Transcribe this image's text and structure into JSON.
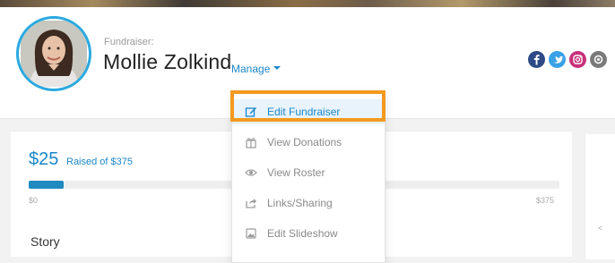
{
  "profile": {
    "label": "Fundraiser:",
    "name": "Mollie Zolkind",
    "manage_label": "Manage"
  },
  "social": [
    {
      "icon": "facebook-icon",
      "color": "#2d4a86"
    },
    {
      "icon": "twitter-icon",
      "color": "#3aa1e6"
    },
    {
      "icon": "instagram-icon",
      "color": "#c8307a"
    },
    {
      "icon": "email-icon",
      "color": "#7a7a7a"
    }
  ],
  "campaign": {
    "raised_amount": "$25",
    "raised_of": "Raised of $375",
    "range_min": "$0",
    "range_max": "$375",
    "progress_fraction": 0.0667,
    "story_heading": "Story"
  },
  "menu": {
    "items": [
      {
        "label": "Edit Fundraiser",
        "icon": "edit-icon"
      },
      {
        "label": "View Donations",
        "icon": "gift-icon"
      },
      {
        "label": "View Roster",
        "icon": "eye-icon"
      },
      {
        "label": "Links/Sharing",
        "icon": "share-icon"
      },
      {
        "label": "Edit Slideshow",
        "icon": "image-icon"
      }
    ]
  },
  "colors": {
    "accent": "#1b87c9",
    "highlight": "#f39a1f",
    "avatar_ring": "#2aa9e0"
  }
}
